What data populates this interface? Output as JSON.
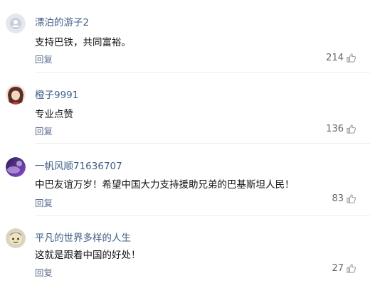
{
  "comments": [
    {
      "username": "漂泊的游子2",
      "text": "支持巴铁，共同富裕。",
      "reply": "回复",
      "likes": "214",
      "avatar_icon": "default-user-avatar-icon"
    },
    {
      "username": "橙子9991",
      "text": "专业点赞",
      "reply": "回复",
      "likes": "136",
      "avatar_icon": "girl-avatar-icon"
    },
    {
      "username": "一帆风顺71636707",
      "text": "中巴友谊万岁！希望中国大力支持援助兄弟的巴基斯坦人民！",
      "reply": "回复",
      "likes": "83",
      "avatar_icon": "purple-photo-avatar-icon"
    },
    {
      "username": "平凡的世界多样的人生",
      "text": "这就是跟着中国的好处！",
      "reply": "回复",
      "likes": "27",
      "avatar_icon": "cartoon-avatar-icon"
    }
  ],
  "colors": {
    "username": "#3f5d86",
    "text": "#111111",
    "reply": "#5a6e8c",
    "like_count": "#666666"
  }
}
